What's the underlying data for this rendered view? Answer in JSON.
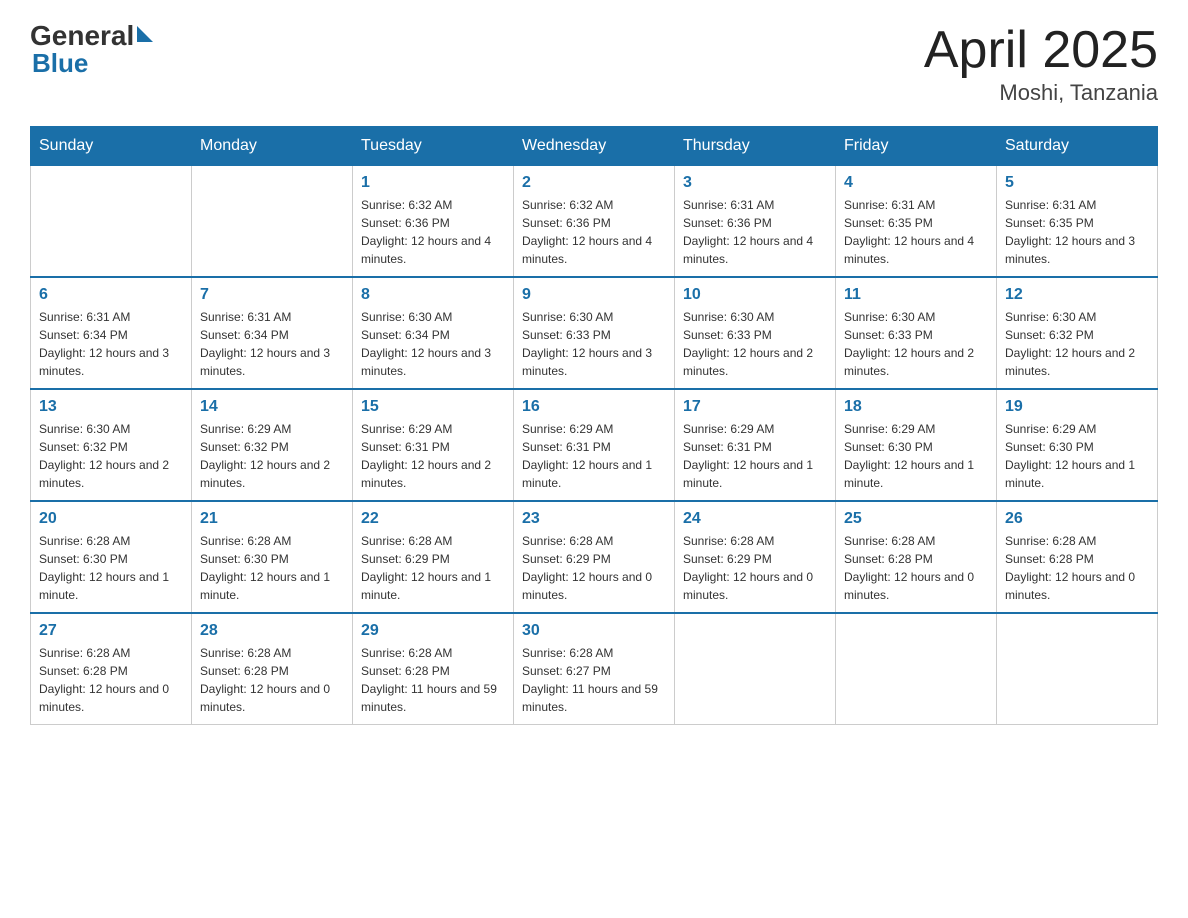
{
  "header": {
    "logo_general": "General",
    "logo_blue": "Blue",
    "title": "April 2025",
    "subtitle": "Moshi, Tanzania"
  },
  "days_of_week": [
    "Sunday",
    "Monday",
    "Tuesday",
    "Wednesday",
    "Thursday",
    "Friday",
    "Saturday"
  ],
  "weeks": [
    [
      {
        "day": "",
        "info": ""
      },
      {
        "day": "",
        "info": ""
      },
      {
        "day": "1",
        "info": "Sunrise: 6:32 AM\nSunset: 6:36 PM\nDaylight: 12 hours and 4 minutes."
      },
      {
        "day": "2",
        "info": "Sunrise: 6:32 AM\nSunset: 6:36 PM\nDaylight: 12 hours and 4 minutes."
      },
      {
        "day": "3",
        "info": "Sunrise: 6:31 AM\nSunset: 6:36 PM\nDaylight: 12 hours and 4 minutes."
      },
      {
        "day": "4",
        "info": "Sunrise: 6:31 AM\nSunset: 6:35 PM\nDaylight: 12 hours and 4 minutes."
      },
      {
        "day": "5",
        "info": "Sunrise: 6:31 AM\nSunset: 6:35 PM\nDaylight: 12 hours and 3 minutes."
      }
    ],
    [
      {
        "day": "6",
        "info": "Sunrise: 6:31 AM\nSunset: 6:34 PM\nDaylight: 12 hours and 3 minutes."
      },
      {
        "day": "7",
        "info": "Sunrise: 6:31 AM\nSunset: 6:34 PM\nDaylight: 12 hours and 3 minutes."
      },
      {
        "day": "8",
        "info": "Sunrise: 6:30 AM\nSunset: 6:34 PM\nDaylight: 12 hours and 3 minutes."
      },
      {
        "day": "9",
        "info": "Sunrise: 6:30 AM\nSunset: 6:33 PM\nDaylight: 12 hours and 3 minutes."
      },
      {
        "day": "10",
        "info": "Sunrise: 6:30 AM\nSunset: 6:33 PM\nDaylight: 12 hours and 2 minutes."
      },
      {
        "day": "11",
        "info": "Sunrise: 6:30 AM\nSunset: 6:33 PM\nDaylight: 12 hours and 2 minutes."
      },
      {
        "day": "12",
        "info": "Sunrise: 6:30 AM\nSunset: 6:32 PM\nDaylight: 12 hours and 2 minutes."
      }
    ],
    [
      {
        "day": "13",
        "info": "Sunrise: 6:30 AM\nSunset: 6:32 PM\nDaylight: 12 hours and 2 minutes."
      },
      {
        "day": "14",
        "info": "Sunrise: 6:29 AM\nSunset: 6:32 PM\nDaylight: 12 hours and 2 minutes."
      },
      {
        "day": "15",
        "info": "Sunrise: 6:29 AM\nSunset: 6:31 PM\nDaylight: 12 hours and 2 minutes."
      },
      {
        "day": "16",
        "info": "Sunrise: 6:29 AM\nSunset: 6:31 PM\nDaylight: 12 hours and 1 minute."
      },
      {
        "day": "17",
        "info": "Sunrise: 6:29 AM\nSunset: 6:31 PM\nDaylight: 12 hours and 1 minute."
      },
      {
        "day": "18",
        "info": "Sunrise: 6:29 AM\nSunset: 6:30 PM\nDaylight: 12 hours and 1 minute."
      },
      {
        "day": "19",
        "info": "Sunrise: 6:29 AM\nSunset: 6:30 PM\nDaylight: 12 hours and 1 minute."
      }
    ],
    [
      {
        "day": "20",
        "info": "Sunrise: 6:28 AM\nSunset: 6:30 PM\nDaylight: 12 hours and 1 minute."
      },
      {
        "day": "21",
        "info": "Sunrise: 6:28 AM\nSunset: 6:30 PM\nDaylight: 12 hours and 1 minute."
      },
      {
        "day": "22",
        "info": "Sunrise: 6:28 AM\nSunset: 6:29 PM\nDaylight: 12 hours and 1 minute."
      },
      {
        "day": "23",
        "info": "Sunrise: 6:28 AM\nSunset: 6:29 PM\nDaylight: 12 hours and 0 minutes."
      },
      {
        "day": "24",
        "info": "Sunrise: 6:28 AM\nSunset: 6:29 PM\nDaylight: 12 hours and 0 minutes."
      },
      {
        "day": "25",
        "info": "Sunrise: 6:28 AM\nSunset: 6:28 PM\nDaylight: 12 hours and 0 minutes."
      },
      {
        "day": "26",
        "info": "Sunrise: 6:28 AM\nSunset: 6:28 PM\nDaylight: 12 hours and 0 minutes."
      }
    ],
    [
      {
        "day": "27",
        "info": "Sunrise: 6:28 AM\nSunset: 6:28 PM\nDaylight: 12 hours and 0 minutes."
      },
      {
        "day": "28",
        "info": "Sunrise: 6:28 AM\nSunset: 6:28 PM\nDaylight: 12 hours and 0 minutes."
      },
      {
        "day": "29",
        "info": "Sunrise: 6:28 AM\nSunset: 6:28 PM\nDaylight: 11 hours and 59 minutes."
      },
      {
        "day": "30",
        "info": "Sunrise: 6:28 AM\nSunset: 6:27 PM\nDaylight: 11 hours and 59 minutes."
      },
      {
        "day": "",
        "info": ""
      },
      {
        "day": "",
        "info": ""
      },
      {
        "day": "",
        "info": ""
      }
    ]
  ]
}
